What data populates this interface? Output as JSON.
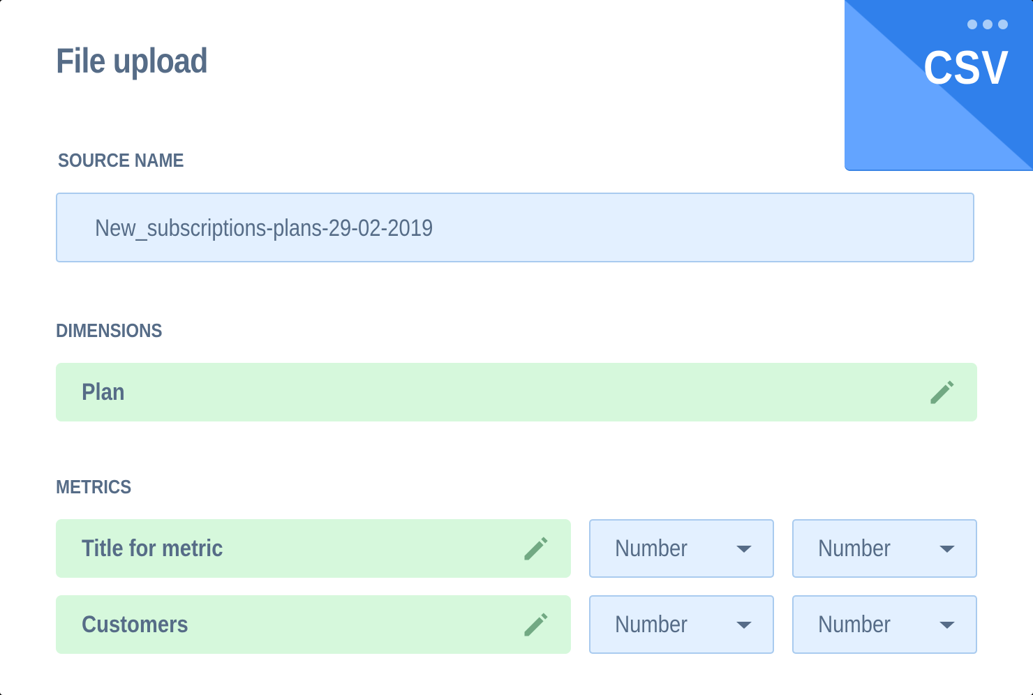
{
  "header": {
    "title": "File upload"
  },
  "file_badge": {
    "label": "CSV",
    "menu_icon": "more-horizontal-icon",
    "colors": {
      "light": "#63a4ff",
      "dark": "#3080eb",
      "dots": "#a9cdf8"
    }
  },
  "source_name": {
    "label": "SOURCE NAME",
    "value": "New_subscriptions-plans-29-02-2019"
  },
  "dimensions": {
    "label": "DIMENSIONS",
    "items": [
      {
        "name": "Plan",
        "icon": "pencil-icon"
      }
    ]
  },
  "metrics": {
    "label": "METRICS",
    "items": [
      {
        "name": "Title for metric",
        "icon": "pencil-icon",
        "type_1": "Number",
        "type_2": "Number"
      },
      {
        "name": "Customers",
        "icon": "pencil-icon",
        "type_1": "Number",
        "type_2": "Number"
      }
    ]
  },
  "colors": {
    "text": "#566c87",
    "field_blue_bg": "#e3f0ff",
    "field_blue_border": "#a9cbef",
    "field_green_bg": "#d6f8dc",
    "pencil_green": "#72a983"
  }
}
